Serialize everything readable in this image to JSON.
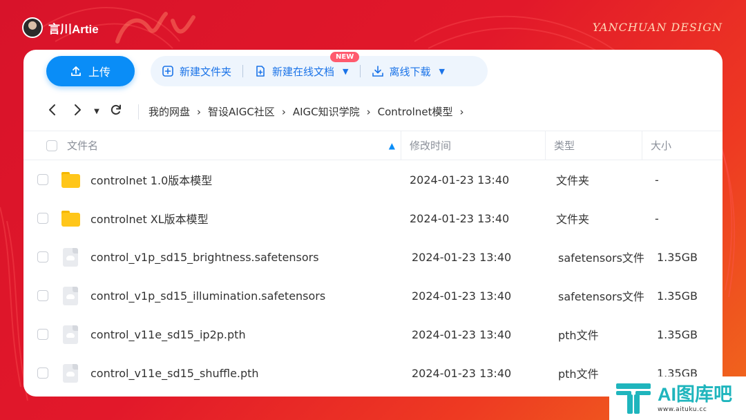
{
  "branding": {
    "author_name": "言川Artie",
    "right_label": "YANCHUAN DESIGN",
    "logo_title": "AI图库吧",
    "logo_url": "www.aituku.cc"
  },
  "toolbar": {
    "upload_label": "上传",
    "new_folder_label": "新建文件夹",
    "new_online_doc_label": "新建在线文档",
    "new_badge": "NEW",
    "offline_download_label": "离线下载"
  },
  "breadcrumb": [
    "我的网盘",
    "智设AIGC社区",
    "AIGC知识学院",
    "Controlnet模型"
  ],
  "table": {
    "headers": {
      "name": "文件名",
      "modified": "修改时间",
      "type": "类型",
      "size": "大小"
    },
    "rows": [
      {
        "name": "controlnet 1.0版本模型",
        "modified": "2024-01-23 13:40",
        "type": "文件夹",
        "size": "-",
        "icon": "folder-icon"
      },
      {
        "name": "controlnet XL版本模型",
        "modified": "2024-01-23 13:40",
        "type": "文件夹",
        "size": "-",
        "icon": "folder-icon"
      },
      {
        "name": "control_v1p_sd15_brightness.safetensors",
        "modified": "2024-01-23 13:40",
        "type": "safetensors文件",
        "size": "1.35GB",
        "icon": "file-icon"
      },
      {
        "name": "control_v1p_sd15_illumination.safetensors",
        "modified": "2024-01-23 13:40",
        "type": "safetensors文件",
        "size": "1.35GB",
        "icon": "file-icon"
      },
      {
        "name": "control_v11e_sd15_ip2p.pth",
        "modified": "2024-01-23 13:40",
        "type": "pth文件",
        "size": "1.35GB",
        "icon": "file-icon"
      },
      {
        "name": "control_v11e_sd15_shuffle.pth",
        "modified": "2024-01-23 13:40",
        "type": "pth文件",
        "size": "1.35GB",
        "icon": "file-icon"
      }
    ]
  },
  "colors": {
    "accent": "#0a8df7",
    "background": "#e2182a",
    "folder": "#ffc61a",
    "logo": "#1fb5bd"
  }
}
